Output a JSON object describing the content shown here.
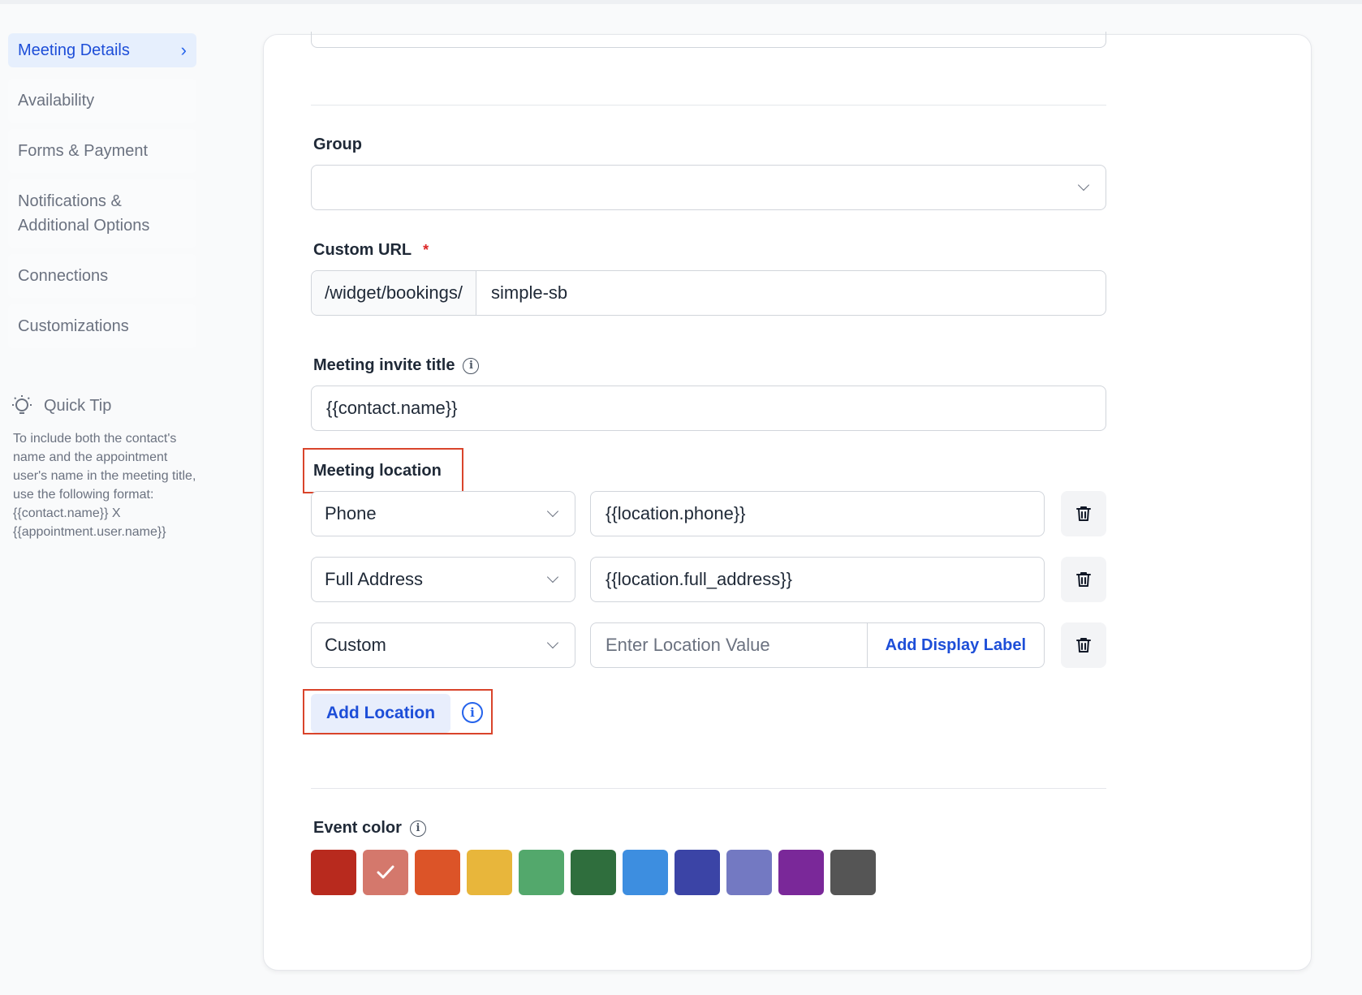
{
  "sidebar": {
    "items": [
      {
        "label": "Meeting Details"
      },
      {
        "label": "Availability"
      },
      {
        "label": "Forms & Payment"
      },
      {
        "label": "Notifications & Additional Options"
      },
      {
        "label": "Connections"
      },
      {
        "label": "Customizations"
      }
    ]
  },
  "quick_tip": {
    "title": "Quick Tip",
    "text": "To include both the contact's name and the appointment user's name in the meeting title, use the following format: {{contact.name}} X {{appointment.user.name}}"
  },
  "form": {
    "group_label": "Group",
    "group_value": "",
    "custom_url_label": "Custom URL",
    "custom_url_required": "*",
    "custom_url_prefix": "/widget/bookings/",
    "custom_url_value": "simple-sb",
    "invite_title_label": "Meeting invite title",
    "invite_title_value": "{{contact.name}}",
    "location_label": "Meeting location",
    "locations": [
      {
        "type": "Phone",
        "value": "{{location.phone}}"
      },
      {
        "type": "Full Address",
        "value": "{{location.full_address}}"
      },
      {
        "type": "Custom",
        "placeholder": "Enter Location Value",
        "display_label_button": "Add Display Label"
      }
    ],
    "add_location_label": "Add Location",
    "event_color_label": "Event color",
    "event_colors": [
      "#b82a1e",
      "#d4786c",
      "#dc5428",
      "#e8b63b",
      "#53a86c",
      "#2f6e3d",
      "#3d8ee0",
      "#3b44a6",
      "#7379c2",
      "#7a2899",
      "#555555"
    ],
    "selected_color": "#d4786c"
  }
}
